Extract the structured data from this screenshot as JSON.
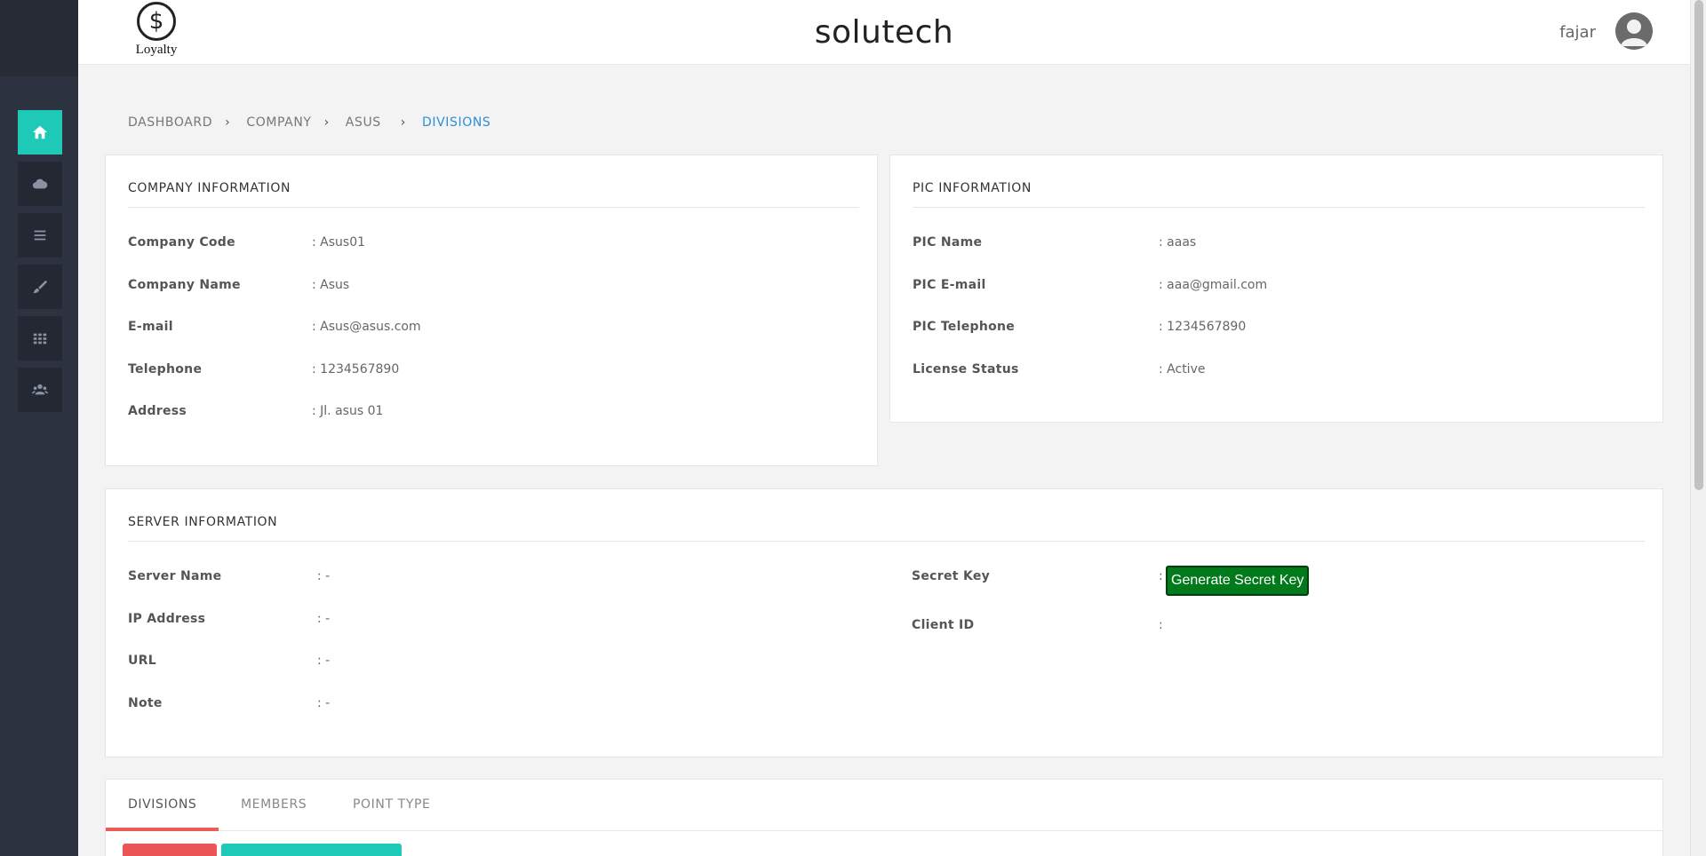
{
  "header": {
    "logo_text": "Loyalty",
    "app_title": "solutech",
    "user_name": "fajar"
  },
  "sidebar": {
    "items": [
      {
        "icon": "home-icon",
        "active": true
      },
      {
        "icon": "cloud-icon",
        "active": false
      },
      {
        "icon": "list-icon",
        "active": false
      },
      {
        "icon": "brush-icon",
        "active": false
      },
      {
        "icon": "grid-icon",
        "active": false
      },
      {
        "icon": "users-icon",
        "active": false
      }
    ]
  },
  "breadcrumb": [
    "DASHBOARD",
    "COMPANY",
    "ASUS",
    "DIVISIONS"
  ],
  "company_info": {
    "title": "COMPANY INFORMATION",
    "fields": [
      {
        "label": "Company Code",
        "value": ": Asus01"
      },
      {
        "label": "Company Name",
        "value": ": Asus"
      },
      {
        "label": "E-mail",
        "value": ": Asus@asus.com"
      },
      {
        "label": "Telephone",
        "value": ": 1234567890"
      },
      {
        "label": "Address",
        "value": ": Jl. asus 01"
      }
    ]
  },
  "pic_info": {
    "title": "PIC INFORMATION",
    "fields": [
      {
        "label": "PIC Name",
        "value": ": aaas"
      },
      {
        "label": "PIC E-mail",
        "value": ": aaa@gmail.com"
      },
      {
        "label": "PIC Telephone",
        "value": ": 1234567890"
      },
      {
        "label": "License Status",
        "value": ": Active"
      }
    ]
  },
  "server_info": {
    "title": "SERVER INFORMATION",
    "fields": [
      {
        "label": "Server Name",
        "value": ": -"
      },
      {
        "label": "IP Address",
        "value": ": -"
      },
      {
        "label": "URL",
        "value": ": -"
      },
      {
        "label": "Note",
        "value": ": -"
      }
    ],
    "right_fields": [
      {
        "label": "Secret Key",
        "value": ":"
      },
      {
        "label": "Client ID",
        "value": ":"
      }
    ],
    "generate_button": "Generate Secret Key"
  },
  "tabs": [
    "DIVISIONS",
    "MEMBERS",
    "POINT TYPE"
  ],
  "colors": {
    "accent": "#1ec9b7",
    "link": "#2a8fd6",
    "tab_underline": "#ea5c5c",
    "generate_button": "#007a1a"
  }
}
